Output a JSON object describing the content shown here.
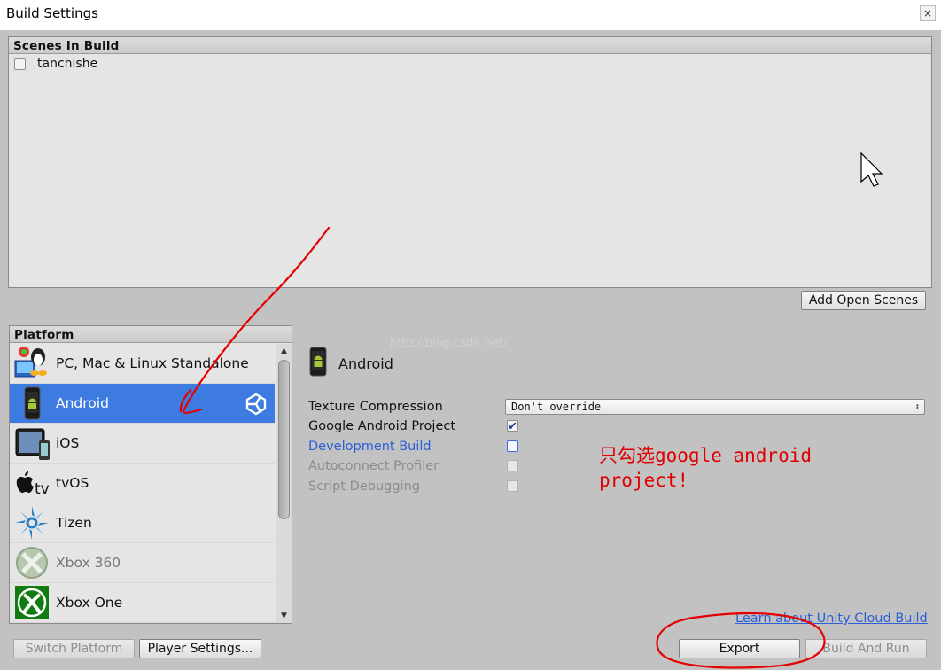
{
  "window": {
    "title": "Build Settings",
    "close_glyph": "×"
  },
  "scenes": {
    "header": "Scenes In Build",
    "items": [
      {
        "name": "tanchishe",
        "checked": false
      }
    ],
    "add_open_scenes_label": "Add Open Scenes"
  },
  "platform_panel": {
    "header": "Platform",
    "items": [
      {
        "label": "PC, Mac & Linux Standalone",
        "icon": "pc-mac-linux-icon"
      },
      {
        "label": "Android",
        "icon": "android-icon",
        "selected": true
      },
      {
        "label": "iOS",
        "icon": "ipad-icon"
      },
      {
        "label": "tvOS",
        "icon": "apple-tv-icon"
      },
      {
        "label": "Tizen",
        "icon": "tizen-icon"
      },
      {
        "label": "Xbox 360",
        "icon": "xbox360-icon"
      },
      {
        "label": "Xbox One",
        "icon": "xbox-one-icon"
      }
    ],
    "switch_platform_label": "Switch Platform",
    "player_settings_label": "Player Settings..."
  },
  "settings": {
    "platform_title": "Android",
    "texture_compression": {
      "label": "Texture Compression",
      "value": "Don't override"
    },
    "google_android_project": {
      "label": "Google Android Project",
      "checked": true
    },
    "development_build": {
      "label": "Development Build",
      "checked": false
    },
    "autoconnect_profiler": {
      "label": "Autoconnect Profiler",
      "checked": false
    },
    "script_debugging": {
      "label": "Script Debugging",
      "checked": false
    }
  },
  "annotation": {
    "line1": "只勾选google android",
    "line2": "project!"
  },
  "watermark": "http://blog.csdn.net/",
  "footer": {
    "cloud_link": "Learn about Unity Cloud Build",
    "export_label": "Export",
    "build_and_run_label": "Build And Run"
  },
  "colors": {
    "selection": "#3d7be0",
    "annotation": "#e00000",
    "link": "#2b5fd7"
  }
}
